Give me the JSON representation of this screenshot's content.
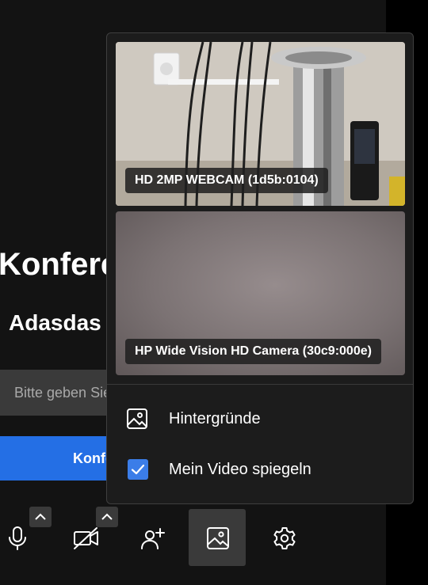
{
  "background": {
    "title": "Konferenz",
    "subtitle": "Adasdas",
    "input_placeholder": "Bitte geben Sie",
    "join_button": "Konferenz"
  },
  "video_menu": {
    "cameras": [
      {
        "label": "HD 2MP WEBCAM (1d5b:0104)",
        "selected": true
      },
      {
        "label": "HP Wide Vision HD Camera (30c9:000e)",
        "selected": false
      }
    ],
    "items": [
      {
        "label": "Hintergründe",
        "icon": "image-icon"
      },
      {
        "label": "Mein Video spiegeln",
        "icon": "checkbox-icon",
        "checked": true
      }
    ]
  },
  "toolbar": {
    "buttons": [
      {
        "name": "microphone",
        "icon": "microphone-icon",
        "has_options": true
      },
      {
        "name": "camera",
        "icon": "camera-off-icon",
        "has_options": true
      },
      {
        "name": "invite",
        "icon": "add-person-icon"
      },
      {
        "name": "background",
        "icon": "image-icon",
        "active": true
      },
      {
        "name": "settings",
        "icon": "gear-icon"
      }
    ]
  },
  "colors": {
    "accent": "#246fe5",
    "checkbox": "#3b7de8",
    "panel": "#1c1c1c",
    "page": "#131313"
  }
}
